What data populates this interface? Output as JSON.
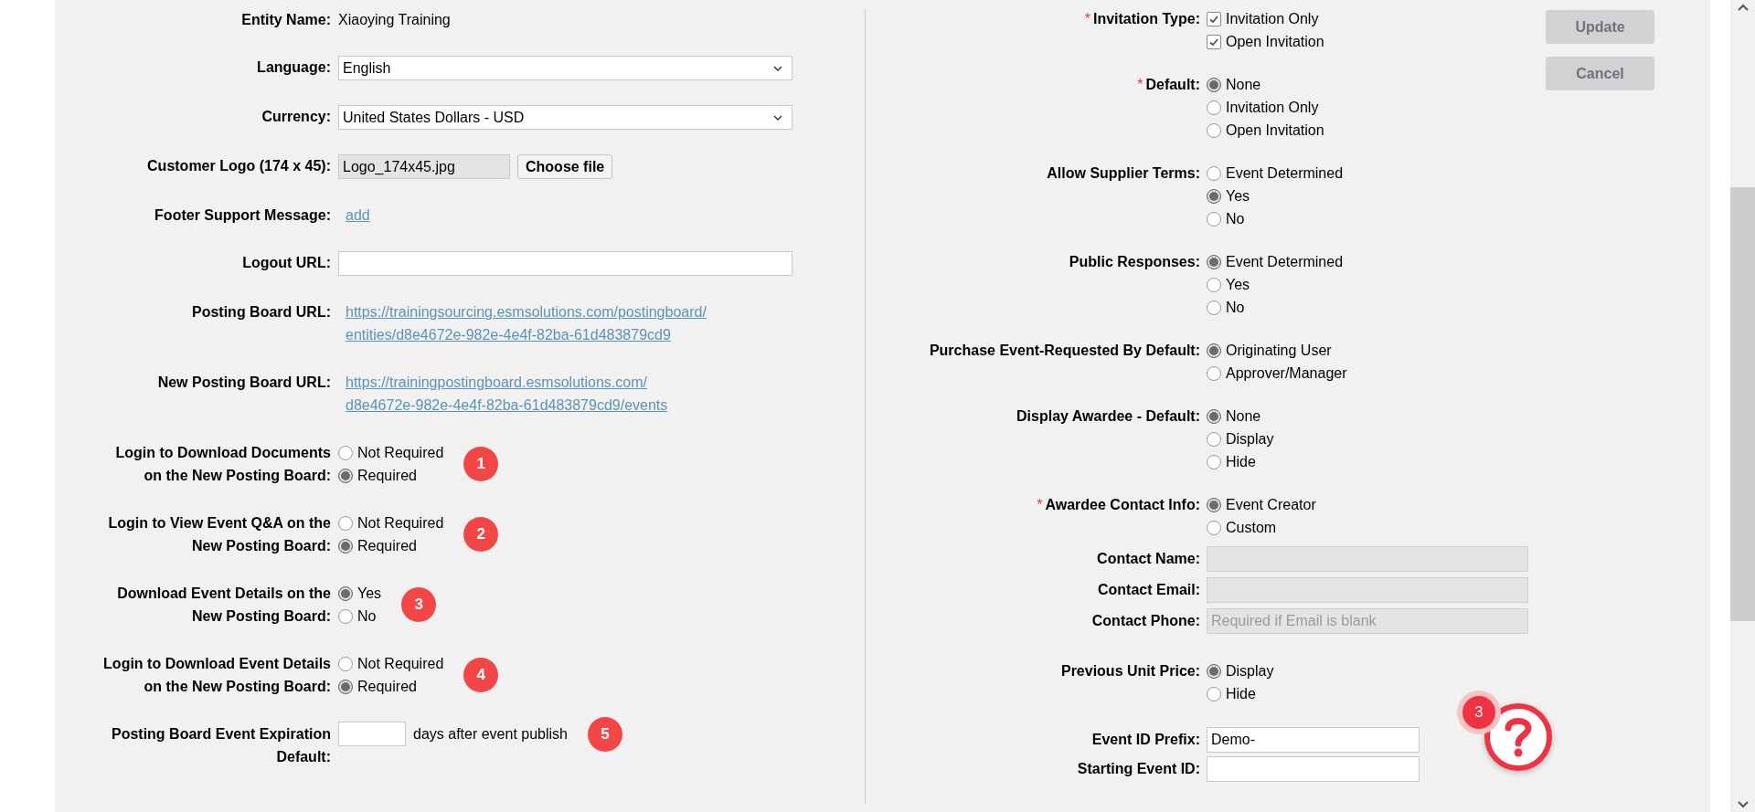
{
  "left_fields": [
    {
      "kind": "text",
      "label_lines": [
        "Entity Name:"
      ],
      "value": "Xiaoying Training"
    },
    {
      "kind": "select",
      "label_lines": [
        "Language:"
      ],
      "value": "English"
    },
    {
      "kind": "select",
      "label_lines": [
        "Currency:"
      ],
      "value": "United States Dollars - USD"
    },
    {
      "kind": "file",
      "label_lines": [
        "Customer Logo (174 x 45):"
      ],
      "value": "Logo_174x45.jpg",
      "button": "Choose file"
    },
    {
      "kind": "link",
      "label_lines": [
        "Footer Support Message:"
      ],
      "lines": [
        "add"
      ]
    },
    {
      "kind": "input",
      "label_lines": [
        "Logout URL:"
      ]
    },
    {
      "kind": "link",
      "label_lines": [
        "Posting Board URL:"
      ],
      "lines": [
        "https://trainingsourcing.esmsolutions.com/postingboard/",
        "entities/d8e4672e-982e-4e4f-82ba-61d483879cd9"
      ]
    },
    {
      "kind": "link",
      "label_lines": [
        "New Posting Board URL:"
      ],
      "lines": [
        "https://trainingpostingboard.esmsolutions.com/",
        "d8e4672e-982e-4e4f-82ba-61d483879cd9/events"
      ]
    },
    {
      "kind": "radio",
      "label_lines": [
        "Login to Download Documents",
        "on the New Posting Board:"
      ],
      "marker": "1",
      "options": [
        {
          "label": "Not Required",
          "selected": false
        },
        {
          "label": "Required",
          "selected": true
        }
      ]
    },
    {
      "kind": "radio",
      "label_lines": [
        "Login to View Event Q&A on the",
        "New Posting Board:"
      ],
      "marker": "2",
      "options": [
        {
          "label": "Not Required",
          "selected": false
        },
        {
          "label": "Required",
          "selected": true
        }
      ]
    },
    {
      "kind": "radio",
      "label_lines": [
        "Download Event Details on the",
        "New Posting Board:"
      ],
      "marker": "3",
      "options": [
        {
          "label": "Yes",
          "selected": true
        },
        {
          "label": "No",
          "selected": false
        }
      ]
    },
    {
      "kind": "radio",
      "label_lines": [
        "Login to Download Event Details",
        "on the New Posting Board:"
      ],
      "marker": "4",
      "options": [
        {
          "label": "Not Required",
          "selected": false
        },
        {
          "label": "Required",
          "selected": true
        }
      ]
    },
    {
      "kind": "days",
      "label_lines": [
        "Posting Board Event Expiration",
        "Default:"
      ],
      "suffix": "days after event publish",
      "marker": "5"
    }
  ],
  "right_fields": [
    {
      "kind": "checkbox",
      "label": "Invitation Type:",
      "required_mark": "*",
      "options": [
        {
          "label": "Invitation Only",
          "checked": true
        },
        {
          "label": "Open Invitation",
          "checked": true
        }
      ]
    },
    {
      "kind": "radio",
      "label": "Default:",
      "required_mark": "*",
      "options": [
        {
          "label": "None",
          "selected": true
        },
        {
          "label": "Invitation Only",
          "selected": false
        },
        {
          "label": "Open Invitation",
          "selected": false
        }
      ]
    },
    {
      "kind": "radio",
      "label": "Allow Supplier Terms:",
      "options": [
        {
          "label": "Event Determined",
          "selected": false
        },
        {
          "label": "Yes",
          "selected": true
        },
        {
          "label": "No",
          "selected": false
        }
      ]
    },
    {
      "kind": "radio",
      "label": "Public Responses:",
      "options": [
        {
          "label": "Event Determined",
          "selected": true
        },
        {
          "label": "Yes",
          "selected": false
        },
        {
          "label": "No",
          "selected": false
        }
      ]
    },
    {
      "kind": "radio",
      "label": "Purchase Event-Requested By Default:",
      "options": [
        {
          "label": "Originating User",
          "selected": true
        },
        {
          "label": "Approver/Manager",
          "selected": false
        }
      ]
    },
    {
      "kind": "radio",
      "label": "Display Awardee - Default:",
      "options": [
        {
          "label": "None",
          "selected": true
        },
        {
          "label": "Display",
          "selected": false
        },
        {
          "label": "Hide",
          "selected": false
        }
      ]
    },
    {
      "kind": "radio",
      "label": "Awardee Contact Info:",
      "required_mark": "*",
      "options": [
        {
          "label": "Event Creator",
          "selected": true
        },
        {
          "label": "Custom",
          "selected": false
        }
      ]
    },
    {
      "kind": "contact",
      "label": "Contact Name:",
      "disabled": true
    },
    {
      "kind": "contact",
      "label": "Contact Email:",
      "disabled": true
    },
    {
      "kind": "contact",
      "label": "Contact Phone:",
      "disabled": true,
      "placeholder": "Required if Email is blank"
    },
    {
      "kind": "radio",
      "label": "Previous Unit Price:",
      "options": [
        {
          "label": "Display",
          "selected": true
        },
        {
          "label": "Hide",
          "selected": false
        }
      ]
    },
    {
      "kind": "short",
      "label": "Event ID Prefix:",
      "value": "Demo-"
    },
    {
      "kind": "short",
      "label": "Starting Event ID:"
    }
  ],
  "buttons": [
    {
      "label": "Update",
      "disabled": true
    },
    {
      "label": "Cancel",
      "disabled": true
    }
  ],
  "help": {
    "badge": "3"
  }
}
